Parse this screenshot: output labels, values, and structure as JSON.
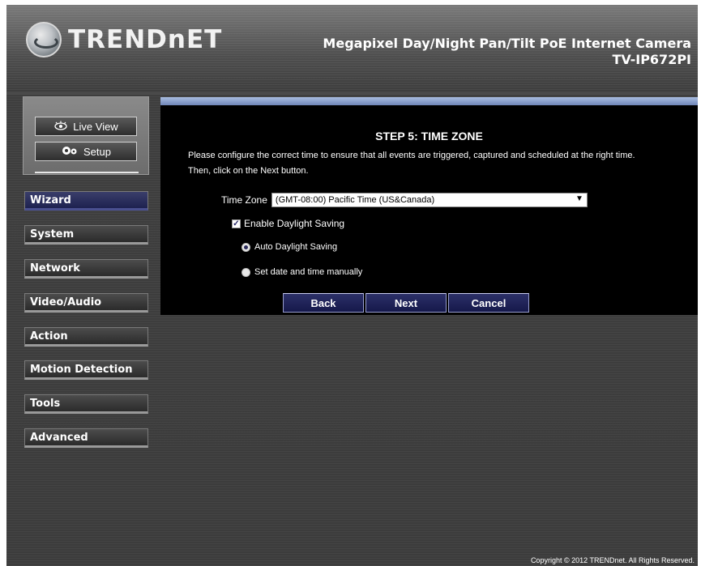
{
  "header": {
    "logo_text": "TRENDnET",
    "product_title": "Megapixel Day/Night Pan/Tilt PoE Internet Camera",
    "product_model": "TV-IP672PI"
  },
  "view_buttons": {
    "live_view": {
      "label": "Live View",
      "icon": "eye-icon"
    },
    "setup": {
      "label": "Setup",
      "icon": "gears-icon"
    }
  },
  "nav": {
    "items": [
      {
        "label": "Wizard",
        "active": true
      },
      {
        "label": "System"
      },
      {
        "label": "Network"
      },
      {
        "label": "Video/Audio"
      },
      {
        "label": "Action"
      },
      {
        "label": "Motion Detection"
      },
      {
        "label": "Tools"
      },
      {
        "label": "Advanced"
      }
    ]
  },
  "content": {
    "step_title": "STEP 5: TIME ZONE",
    "instructions": "Please configure the correct time to ensure that all events are triggered, captured and scheduled at the right time. Then, click on the Next button.",
    "timezone": {
      "label": "Time Zone",
      "value": "(GMT-08:00) Pacific Time (US&Canada)"
    },
    "daylight_saving": {
      "label": "Enable Daylight Saving",
      "checked": true
    },
    "radio_auto": {
      "label": "Auto Daylight Saving",
      "selected": true
    },
    "radio_manual": {
      "label": "Set date and time manually",
      "selected": false
    },
    "buttons": {
      "back": "Back",
      "next": "Next",
      "cancel": "Cancel"
    }
  },
  "footer": {
    "copyright": "Copyright © 2012 TRENDnet. All Rights Reserved."
  },
  "colors": {
    "background": "#3c3c3c",
    "content_bg": "#000000",
    "accent_bar": "#8fa4d0",
    "button_blue": "#1e2258"
  }
}
